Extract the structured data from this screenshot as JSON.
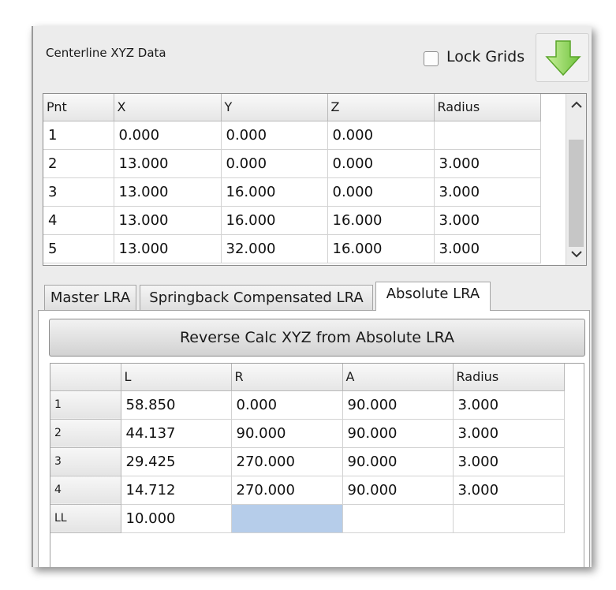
{
  "panel": {
    "title": "Centerline XYZ Data",
    "lock_grids_label": "Lock Grids",
    "lock_grids_checked": false,
    "down_button_icon": "green-down-arrow-icon"
  },
  "xyz_grid": {
    "columns": [
      "Pnt",
      "X",
      "Y",
      "Z",
      "Radius"
    ],
    "rows": [
      [
        "1",
        "0.000",
        "0.000",
        "0.000",
        ""
      ],
      [
        "2",
        "13.000",
        "0.000",
        "0.000",
        "3.000"
      ],
      [
        "3",
        "13.000",
        "16.000",
        "0.000",
        "3.000"
      ],
      [
        "4",
        "13.000",
        "16.000",
        "16.000",
        "3.000"
      ],
      [
        "5",
        "13.000",
        "32.000",
        "16.000",
        "3.000"
      ]
    ],
    "scroll_up_icon": "^",
    "scroll_down_icon": "v"
  },
  "tabs": [
    {
      "label": "Master LRA",
      "active": false
    },
    {
      "label": "Springback Compensated LRA",
      "active": false
    },
    {
      "label": "Absolute LRA",
      "active": true
    }
  ],
  "reverse_button_label": "Reverse Calc XYZ from Absolute LRA",
  "lra_grid": {
    "columns": [
      "",
      "L",
      "R",
      "A",
      "Radius"
    ],
    "rows": [
      [
        "1",
        "58.850",
        "0.000",
        "90.000",
        "3.000"
      ],
      [
        "2",
        "44.137",
        "90.000",
        "90.000",
        "3.000"
      ],
      [
        "3",
        "29.425",
        "270.000",
        "90.000",
        "3.000"
      ],
      [
        "4",
        "14.712",
        "270.000",
        "90.000",
        "3.000"
      ],
      [
        "LL",
        "10.000",
        "",
        "",
        ""
      ]
    ],
    "selected_cell": "LL-R",
    "selection_color": "#b6cdea"
  }
}
